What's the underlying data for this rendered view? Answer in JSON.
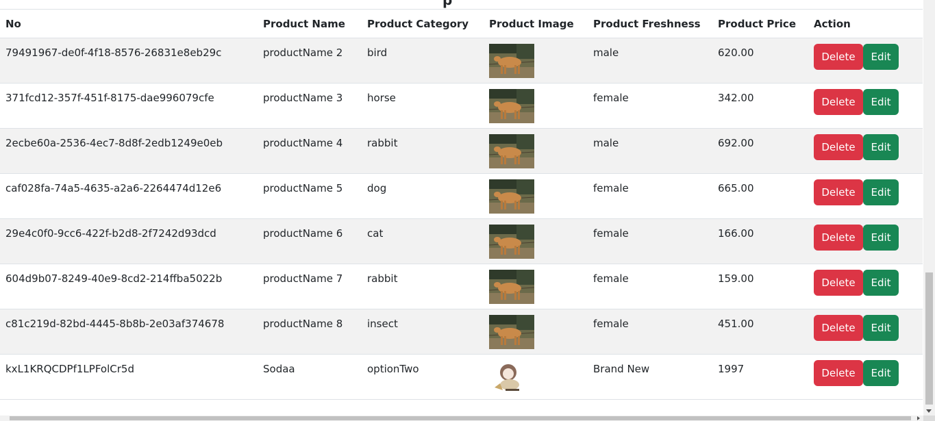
{
  "page": {
    "title_fragment": "p"
  },
  "table": {
    "headers": {
      "no": "No",
      "name": "Product Name",
      "category": "Product Category",
      "image": "Product Image",
      "freshness": "Product Freshness",
      "price": "Product Price",
      "action": "Action"
    },
    "rows": [
      {
        "id": "79491967-de0f-4f18-8576-26831e8eb29c",
        "name": "productName 2",
        "category": "bird",
        "image": "cow-photo",
        "freshness": "male",
        "price": "620.00"
      },
      {
        "id": "371fcd12-357f-451f-8175-dae996079cfe",
        "name": "productName 3",
        "category": "horse",
        "image": "cow-photo",
        "freshness": "female",
        "price": "342.00"
      },
      {
        "id": "2ecbe60a-2536-4ec7-8d8f-2edb1249e0eb",
        "name": "productName 4",
        "category": "rabbit",
        "image": "cow-photo",
        "freshness": "male",
        "price": "692.00"
      },
      {
        "id": "caf028fa-74a5-4635-a2a6-2264474d12e6",
        "name": "productName 5",
        "category": "dog",
        "image": "cow-photo",
        "freshness": "female",
        "price": "665.00"
      },
      {
        "id": "29e4c0f0-9cc6-422f-b2d8-2f7242d93dcd",
        "name": "productName 6",
        "category": "cat",
        "image": "cow-photo",
        "freshness": "female",
        "price": "166.00"
      },
      {
        "id": "604d9b07-8249-40e9-8cd2-214ffba5022b",
        "name": "productName 7",
        "category": "rabbit",
        "image": "cow-photo",
        "freshness": "female",
        "price": "159.00"
      },
      {
        "id": "c81c219d-82bd-4445-8b8b-2e03af374678",
        "name": "productName 8",
        "category": "insect",
        "image": "cow-photo",
        "freshness": "female",
        "price": "451.00"
      },
      {
        "id": "kxL1KRQCDPf1LPFolCr5d",
        "name": "Sodaa",
        "category": "optionTwo",
        "image": "anime-sticker",
        "freshness": "Brand New",
        "price": "1997"
      }
    ],
    "delete_label": "Delete",
    "edit_label": "Edit"
  },
  "colors": {
    "delete": "#dc3545",
    "edit": "#198754",
    "stripe": "#f2f2f2"
  }
}
